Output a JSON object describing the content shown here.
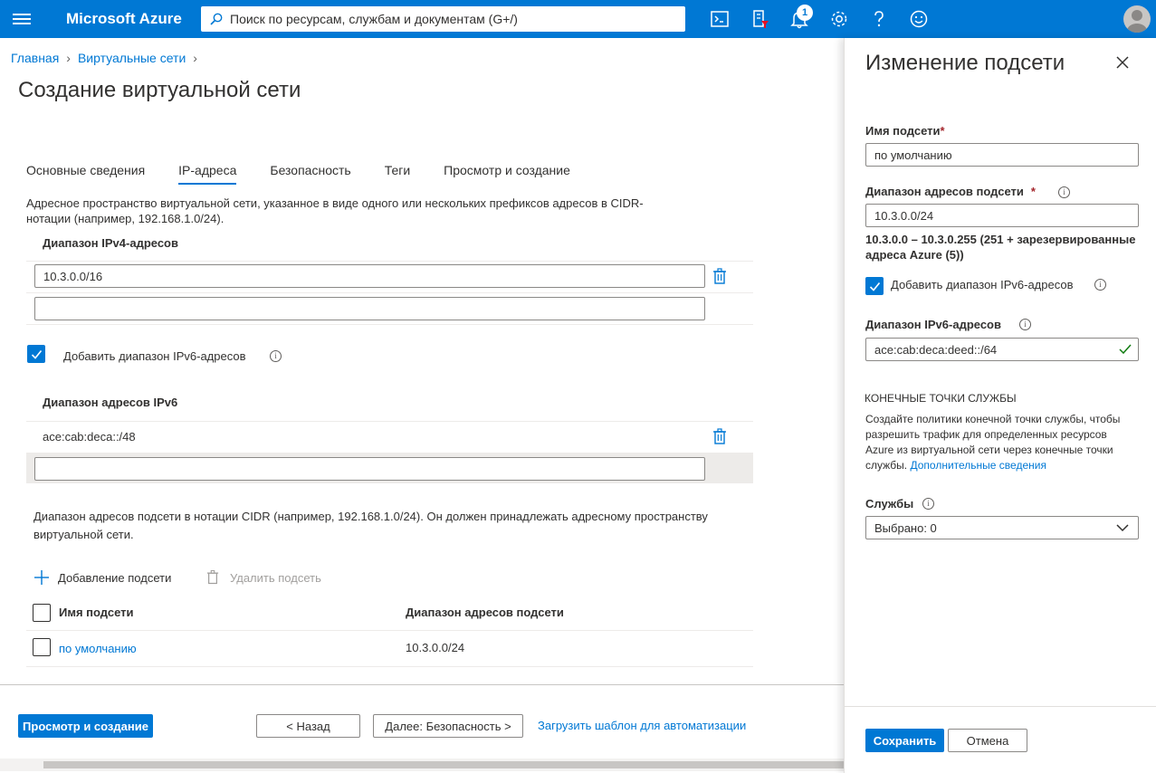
{
  "topbar": {
    "brand": "Microsoft Azure",
    "search_placeholder": "Поиск по ресурсам, службам и документам (G+/)",
    "notification_count": "1",
    "icons": [
      "menu-icon",
      "search-icon",
      "cloud-shell-icon",
      "directory-filter-icon",
      "bell-icon",
      "gear-icon",
      "help-icon",
      "feedback-icon",
      "avatar"
    ]
  },
  "breadcrumb": {
    "home": "Главная",
    "vnets": "Виртуальные сети"
  },
  "page": {
    "title": "Создание виртуальной сети"
  },
  "tabs": [
    {
      "label": "Основные сведения",
      "active": false
    },
    {
      "label": "IP-адреса",
      "active": true
    },
    {
      "label": "Безопасность",
      "active": false
    },
    {
      "label": "Теги",
      "active": false
    },
    {
      "label": "Просмотр и создание",
      "active": false
    }
  ],
  "ip": {
    "description": "Адресное пространство виртуальной сети, указанное в виде одного или нескольких префиксов адресов в CIDR-нотации (например, 192.168.1.0/24).",
    "ipv4_label": "Диапазон IPv4-адресов",
    "ipv4_value": "10.3.0.0/16",
    "ipv4_empty": "",
    "add_ipv6_label": "Добавить диапазон IPv6-адресов",
    "add_ipv6_checked": true,
    "ipv6_label": "Диапазон адресов IPv6",
    "ipv6_value": "ace:cab:deca::/48",
    "ipv6_empty": "",
    "subnet_desc": "Диапазон адресов подсети в нотации CIDR (например, 192.168.1.0/24). Он должен принадлежать адресному пространству виртуальной сети.",
    "add_subnet": "Добавление подсети",
    "delete_subnet": "Удалить подсеть",
    "table": {
      "col_name": "Имя подсети",
      "col_range": "Диапазон адресов подсети",
      "rows": [
        {
          "name": "по умолчанию",
          "range": "10.3.0.0/24"
        }
      ]
    }
  },
  "footer": {
    "review_create": "Просмотр и создание",
    "back": "< Назад",
    "next": "Далее: Безопасность >",
    "template": "Загрузить шаблон для автоматизации"
  },
  "panel": {
    "title": "Изменение подсети",
    "name_label": "Имя подсети",
    "name_value": "по умолчанию",
    "range_label": "Диапазон адресов подсети",
    "range_value": "10.3.0.0/24",
    "range_info": "10.3.0.0 – 10.3.0.255 (251 + зарезервированные адреса Azure (5))",
    "add_ipv6_label": "Добавить диапазон IPv6-адресов",
    "add_ipv6_checked": true,
    "ipv6_label": "Диапазон IPv6-адресов",
    "ipv6_value": "ace:cab:deca:deed::/64",
    "endpoints_heading": "КОНЕЧНЫЕ ТОЧКИ СЛУЖБЫ",
    "endpoints_desc": "Создайте политики конечной точки службы, чтобы разрешить трафик для определенных ресурсов Azure из виртуальной сети через конечные точки службы.",
    "endpoints_link": "Дополнительные сведения",
    "services_label": "Службы",
    "services_value": "Выбрано: 0",
    "save": "Сохранить",
    "cancel": "Отмена"
  },
  "colors": {
    "accent": "#0078d4",
    "text": "#323130",
    "valid": "#107c10"
  }
}
